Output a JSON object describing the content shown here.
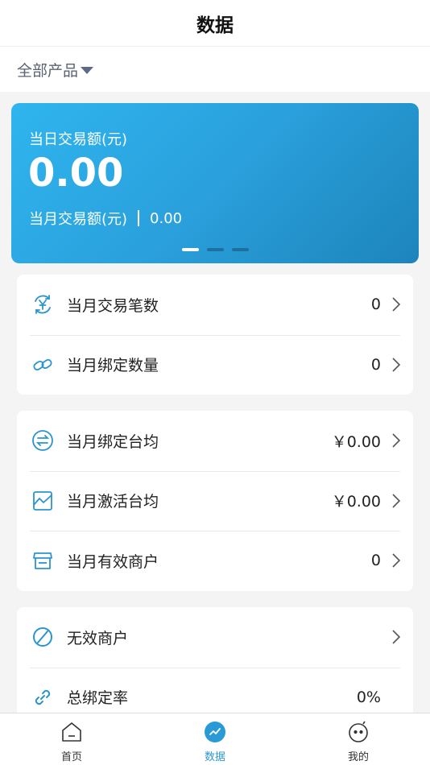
{
  "header": {
    "title": "数据"
  },
  "filter": {
    "label": "全部产品"
  },
  "banner": {
    "daily_label": "当日交易额(元)",
    "daily_value": "0.00",
    "monthly_label": "当月交易额(元)",
    "monthly_value": "0.00",
    "page_count": 3,
    "active_page": 1
  },
  "card1": {
    "rows": [
      {
        "label": "当月交易笔数",
        "value": "0",
        "icon": "yen-cycle-icon"
      },
      {
        "label": "当月绑定数量",
        "value": "0",
        "icon": "link-icon"
      }
    ]
  },
  "card2": {
    "rows": [
      {
        "label": "当月绑定台均",
        "value": "￥0.00",
        "icon": "exchange-icon"
      },
      {
        "label": "当月激活台均",
        "value": "￥0.00",
        "icon": "chart-icon"
      },
      {
        "label": "当月有效商户",
        "value": "0",
        "icon": "store-icon"
      }
    ]
  },
  "card3": {
    "rows": [
      {
        "label": "无效商户",
        "value": "",
        "icon": "ban-icon"
      },
      {
        "label": "总绑定率",
        "value": "0%",
        "icon": "chain-icon"
      }
    ]
  },
  "tabbar": {
    "items": [
      {
        "label": "首页",
        "icon": "home-icon"
      },
      {
        "label": "数据",
        "icon": "data-icon"
      },
      {
        "label": "我的",
        "icon": "profile-icon"
      }
    ],
    "active": 1
  },
  "colors": {
    "accent": "#2a9ad6",
    "icon_blue": "#2b94d0",
    "banner_start": "#2fb5ee",
    "banner_end": "#1d84bb"
  }
}
